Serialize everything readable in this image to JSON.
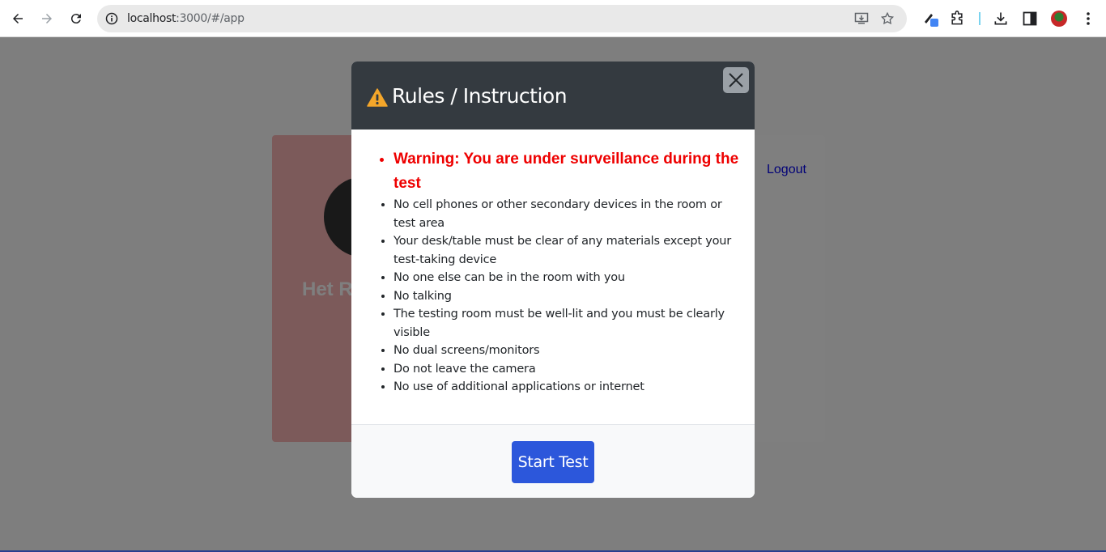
{
  "browser": {
    "url_host": "localhost",
    "url_rest": ":3000/#/app"
  },
  "page": {
    "profile_name": "Het R",
    "logout_label": "Logout"
  },
  "modal": {
    "title": "Rules / Instruction",
    "warning": "Warning: You are under surveillance during the test",
    "rules": [
      "No cell phones or other secondary devices in the room or test area",
      "Your desk/table must be clear of any materials except your test-taking device",
      "No one else can be in the room with you",
      "No talking",
      "The testing room must be well-lit and you must be clearly visible",
      "No dual screens/monitors",
      "Do not leave the camera",
      "No use of additional applications or internet"
    ],
    "start_button_label": "Start Test"
  },
  "colors": {
    "header_bg": "#343a40",
    "warning_text": "#ee0000",
    "primary_button": "#2c57db",
    "warning_icon": "#f4a62a"
  }
}
